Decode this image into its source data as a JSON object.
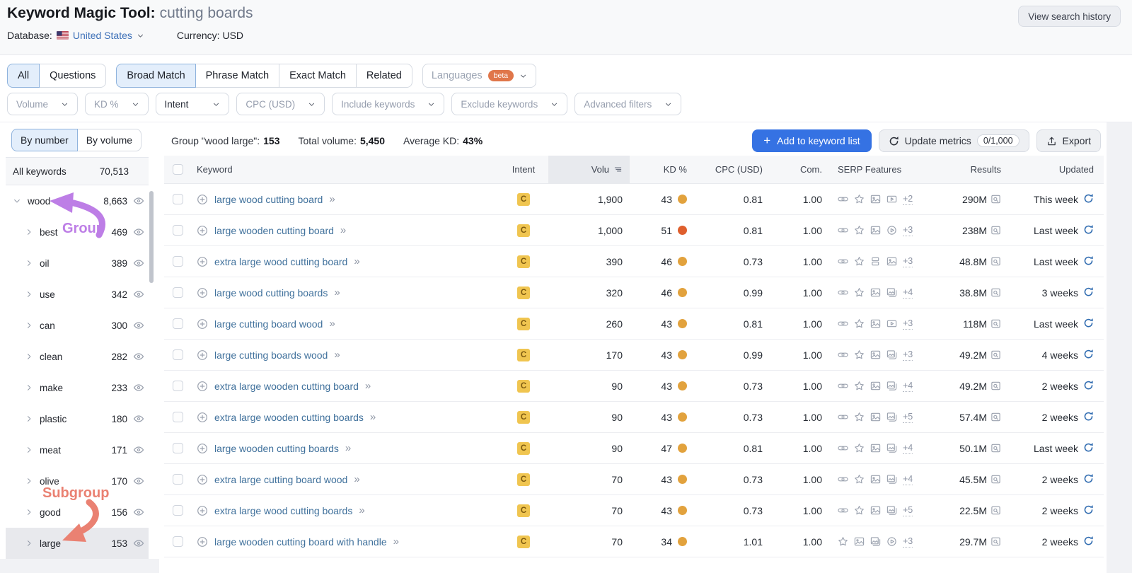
{
  "header": {
    "title": "Keyword Magic Tool:",
    "query": "cutting boards",
    "view_history_label": "View search history",
    "database_label": "Database:",
    "database_value": "United States",
    "currency_label": "Currency: USD"
  },
  "match_tabs": {
    "group1": [
      {
        "label": "All",
        "active": true
      },
      {
        "label": "Questions",
        "active": false
      }
    ],
    "group2": [
      {
        "label": "Broad Match",
        "active": true
      },
      {
        "label": "Phrase Match",
        "active": false
      },
      {
        "label": "Exact Match",
        "active": false
      },
      {
        "label": "Related",
        "active": false
      }
    ],
    "languages": {
      "label": "Languages",
      "badge": "beta"
    }
  },
  "filters": [
    "Volume",
    "KD %",
    "Intent",
    "CPC (USD)",
    "Include keywords",
    "Exclude keywords",
    "Advanced filters"
  ],
  "sidebar": {
    "toggle": [
      {
        "label": "By number",
        "active": true
      },
      {
        "label": "By volume",
        "active": false
      }
    ],
    "all_keywords_label": "All keywords",
    "all_keywords_count": "70,513",
    "groups": [
      {
        "name": "wood",
        "count": "8,663",
        "level": 0,
        "expanded": true,
        "selected": false
      },
      {
        "name": "best",
        "count": "469",
        "level": 1,
        "expanded": false,
        "selected": false
      },
      {
        "name": "oil",
        "count": "389",
        "level": 1,
        "expanded": false,
        "selected": false
      },
      {
        "name": "use",
        "count": "342",
        "level": 1,
        "expanded": false,
        "selected": false
      },
      {
        "name": "can",
        "count": "300",
        "level": 1,
        "expanded": false,
        "selected": false
      },
      {
        "name": "clean",
        "count": "282",
        "level": 1,
        "expanded": false,
        "selected": false
      },
      {
        "name": "make",
        "count": "233",
        "level": 1,
        "expanded": false,
        "selected": false
      },
      {
        "name": "plastic",
        "count": "180",
        "level": 1,
        "expanded": false,
        "selected": false
      },
      {
        "name": "meat",
        "count": "171",
        "level": 1,
        "expanded": false,
        "selected": false
      },
      {
        "name": "olive",
        "count": "170",
        "level": 1,
        "expanded": false,
        "selected": false
      },
      {
        "name": "good",
        "count": "156",
        "level": 1,
        "expanded": false,
        "selected": false
      },
      {
        "name": "large",
        "count": "153",
        "level": 1,
        "expanded": false,
        "selected": true
      }
    ],
    "annotations": {
      "group_label": "Group",
      "subgroup_label": "Subgroup",
      "group_color": "#bd7ee6",
      "subgroup_color": "#ea8172"
    }
  },
  "toolbar": {
    "group_label": "Group \"wood large\":",
    "group_count": "153",
    "total_volume_label": "Total volume:",
    "total_volume": "5,450",
    "avg_kd_label": "Average KD:",
    "avg_kd": "43%",
    "add_button": "Add to keyword list",
    "update_metrics_label": "Update metrics",
    "update_metrics_count": "0/1,000",
    "export_label": "Export"
  },
  "table": {
    "columns": {
      "keyword": "Keyword",
      "intent": "Intent",
      "volume": "Volu",
      "kd": "KD %",
      "cpc": "CPC (USD)",
      "com": "Com.",
      "serp": "SERP Features",
      "results": "Results",
      "updated": "Updated"
    },
    "rows": [
      {
        "keyword": "large wood cutting board",
        "intent": "C",
        "volume": "1,900",
        "kd": "43",
        "kd_color": "#e2a23d",
        "cpc": "0.81",
        "com": "1.00",
        "serp": [
          "link",
          "star",
          "image",
          "video"
        ],
        "serp_more": "+2",
        "results": "290M",
        "updated": "This week"
      },
      {
        "keyword": "large wooden cutting board",
        "intent": "C",
        "volume": "1,000",
        "kd": "51",
        "kd_color": "#df5f2d",
        "cpc": "0.81",
        "com": "1.00",
        "serp": [
          "link",
          "star",
          "image",
          "play"
        ],
        "serp_more": "+3",
        "results": "238M",
        "updated": "Last week"
      },
      {
        "keyword": "extra large wood cutting board",
        "intent": "C",
        "volume": "390",
        "kd": "46",
        "kd_color": "#e2a23d",
        "cpc": "0.73",
        "com": "1.00",
        "serp": [
          "link",
          "star",
          "carousel",
          "image"
        ],
        "serp_more": "+3",
        "results": "48.8M",
        "updated": "Last week"
      },
      {
        "keyword": "large wood cutting boards",
        "intent": "C",
        "volume": "320",
        "kd": "46",
        "kd_color": "#e2a23d",
        "cpc": "0.99",
        "com": "1.00",
        "serp": [
          "link",
          "star",
          "image",
          "images"
        ],
        "serp_more": "+4",
        "results": "38.8M",
        "updated": "3 weeks"
      },
      {
        "keyword": "large cutting board wood",
        "intent": "C",
        "volume": "260",
        "kd": "43",
        "kd_color": "#e2a23d",
        "cpc": "0.81",
        "com": "1.00",
        "serp": [
          "link",
          "star",
          "image",
          "video"
        ],
        "serp_more": "+3",
        "results": "118M",
        "updated": "Last week"
      },
      {
        "keyword": "large cutting boards wood",
        "intent": "C",
        "volume": "170",
        "kd": "43",
        "kd_color": "#e2a23d",
        "cpc": "0.99",
        "com": "1.00",
        "serp": [
          "link",
          "star",
          "image",
          "images"
        ],
        "serp_more": "+3",
        "results": "49.2M",
        "updated": "4 weeks"
      },
      {
        "keyword": "extra large wooden cutting board",
        "intent": "C",
        "volume": "90",
        "kd": "43",
        "kd_color": "#e2a23d",
        "cpc": "0.73",
        "com": "1.00",
        "serp": [
          "link",
          "star",
          "image",
          "images"
        ],
        "serp_more": "+4",
        "results": "49.2M",
        "updated": "2 weeks"
      },
      {
        "keyword": "extra large wooden cutting boards",
        "intent": "C",
        "volume": "90",
        "kd": "43",
        "kd_color": "#e2a23d",
        "cpc": "0.73",
        "com": "1.00",
        "serp": [
          "link",
          "star",
          "image",
          "images"
        ],
        "serp_more": "+5",
        "results": "57.4M",
        "updated": "2 weeks"
      },
      {
        "keyword": "large wooden cutting boards",
        "intent": "C",
        "volume": "90",
        "kd": "47",
        "kd_color": "#e2a23d",
        "cpc": "0.81",
        "com": "1.00",
        "serp": [
          "link",
          "star",
          "image",
          "images"
        ],
        "serp_more": "+4",
        "results": "50.1M",
        "updated": "Last week"
      },
      {
        "keyword": "extra large cutting board wood",
        "intent": "C",
        "volume": "70",
        "kd": "43",
        "kd_color": "#e2a23d",
        "cpc": "0.73",
        "com": "1.00",
        "serp": [
          "link",
          "star",
          "image",
          "images"
        ],
        "serp_more": "+4",
        "results": "45.5M",
        "updated": "2 weeks"
      },
      {
        "keyword": "extra large wood cutting boards",
        "intent": "C",
        "volume": "70",
        "kd": "43",
        "kd_color": "#e2a23d",
        "cpc": "0.73",
        "com": "1.00",
        "serp": [
          "link",
          "star",
          "image",
          "images"
        ],
        "serp_more": "+5",
        "results": "22.5M",
        "updated": "2 weeks"
      },
      {
        "keyword": "large wooden cutting board with handle",
        "intent": "C",
        "volume": "70",
        "kd": "34",
        "kd_color": "#e2a23d",
        "cpc": "1.01",
        "com": "1.00",
        "serp": [
          "star",
          "image",
          "images",
          "play"
        ],
        "serp_more": "+3",
        "results": "29.7M",
        "updated": "2 weeks"
      }
    ]
  }
}
